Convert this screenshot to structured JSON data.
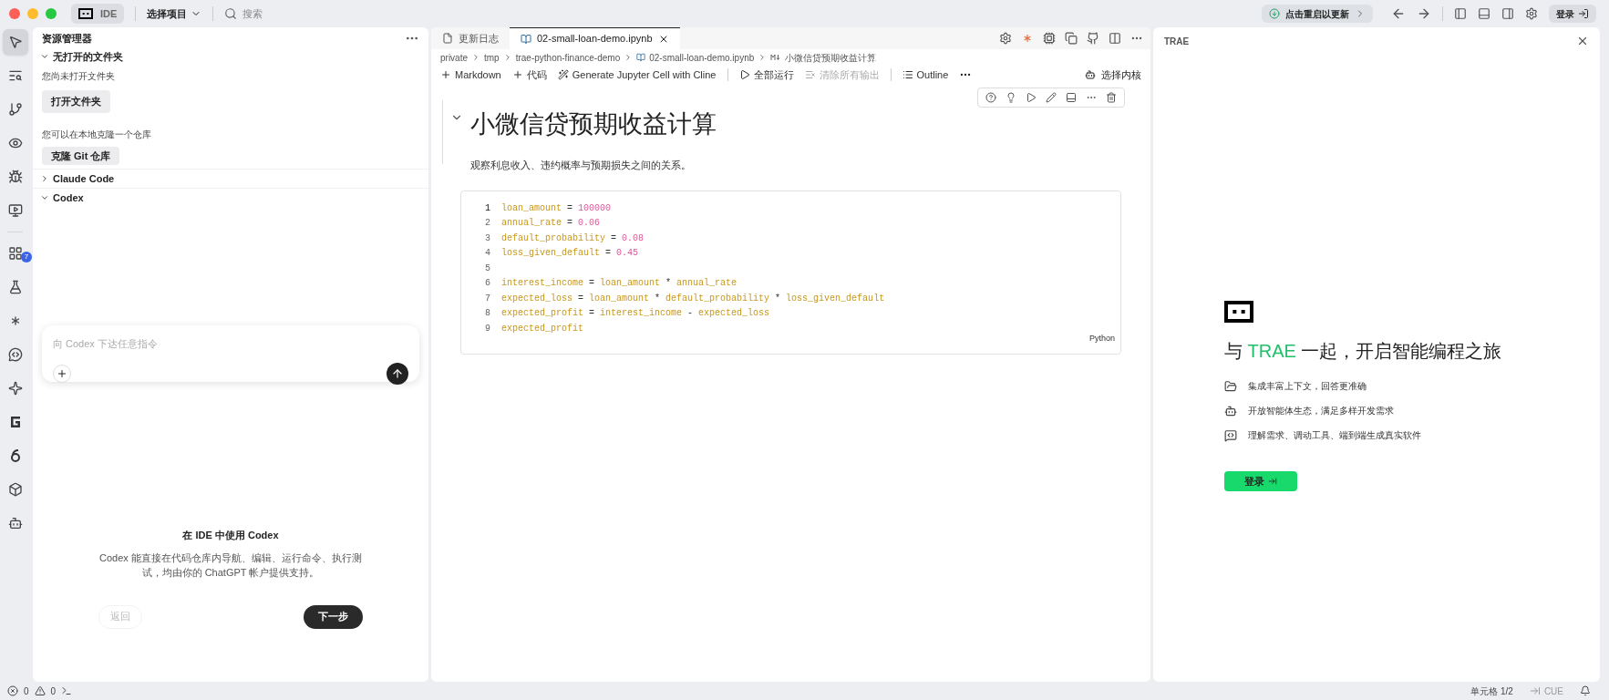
{
  "titlebar": {
    "mode_label": "IDE",
    "mode_selected": true,
    "project": "选择项目",
    "search": {
      "placeholder": "搜索"
    },
    "update": "点击重启以更新",
    "login": "登录"
  },
  "activity_bar": [
    {
      "kind": "cursor",
      "selected": true
    },
    {
      "kind": "search",
      "selected": false
    },
    {
      "kind": "branch",
      "selected": false
    },
    {
      "kind": "eye",
      "selected": false
    },
    {
      "kind": "bug",
      "selected": false
    },
    {
      "kind": "monitor",
      "selected": false
    },
    {
      "kind": "grid",
      "selected": false,
      "badge": "7"
    },
    {
      "kind": "flask",
      "selected": false
    },
    {
      "kind": "burst",
      "selected": false
    },
    {
      "kind": "chat",
      "selected": false
    },
    {
      "kind": "star",
      "selected": false
    },
    {
      "kind": "g",
      "selected": false
    },
    {
      "kind": "six",
      "selected": false
    },
    {
      "kind": "box",
      "selected": false
    },
    {
      "kind": "robot",
      "selected": false
    }
  ],
  "explorer": {
    "title": "资源管理器",
    "folder_section": {
      "title": "无打开的文件夹",
      "expanded": true,
      "message": "您尚未打开文件夹",
      "open_button": "打开文件夹",
      "clone_message": "您可以在本地克隆一个仓库",
      "clone_button": "克隆 Git 仓库"
    },
    "sections": [
      {
        "title": "Claude Code",
        "expanded": false
      },
      {
        "title": "Codex",
        "expanded": true
      }
    ],
    "codex": {
      "prompt": {
        "placeholder": "向 Codex 下达任意指令"
      },
      "heading": "在 IDE 中使用 Codex",
      "description": "Codex 能直接在代码仓库内导航、编辑、运行命令、执行测试，均由你的 ChatGPT 帐户提供支持。",
      "back_button": "返回",
      "next_button": "下一步"
    }
  },
  "editor": {
    "tabs": [
      {
        "label": "更新日志",
        "kind": "file",
        "selected": false
      },
      {
        "label": "02-small-loan-demo.ipynb",
        "kind": "notebook",
        "selected": true
      }
    ],
    "breadcrumb": [
      {
        "label": "private",
        "kind": "folder"
      },
      {
        "label": "tmp",
        "kind": "folder"
      },
      {
        "label": "trae-python-finance-demo",
        "kind": "folder"
      },
      {
        "label": "02-small-loan-demo.ipynb",
        "kind": "notebook"
      },
      {
        "label": "小微信贷预期收益计算",
        "kind": "markdown"
      }
    ],
    "toolbar": [
      {
        "label": "Markdown",
        "kind": "plus",
        "disabled": false
      },
      {
        "label": "代码",
        "kind": "plus",
        "disabled": false
      },
      {
        "label": "Generate Jupyter Cell with Cline",
        "kind": "sparkle",
        "disabled": false
      },
      {
        "label": "全部运行",
        "kind": "run",
        "disabled": false
      },
      {
        "label": "清除所有输出",
        "kind": "clear",
        "disabled": true
      },
      {
        "label": "Outline",
        "kind": "list",
        "disabled": false
      }
    ],
    "kernel": "选择内核",
    "markdown_cell": {
      "heading": "小微信贷预期收益计算",
      "text": "观察利息收入、违约概率与预期损失之间的关系。",
      "expanded": true
    },
    "code_cell": {
      "language": "Python",
      "lines": [
        {
          "number": "1",
          "active": true,
          "tokens": [
            {
              "kind": "var",
              "text": "loan_amount"
            },
            {
              "kind": "op",
              "text": " = "
            },
            {
              "kind": "num",
              "text": "100000"
            }
          ]
        },
        {
          "number": "2",
          "active": false,
          "tokens": [
            {
              "kind": "var",
              "text": "annual_rate"
            },
            {
              "kind": "op",
              "text": " = "
            },
            {
              "kind": "num",
              "text": "0.06"
            }
          ]
        },
        {
          "number": "3",
          "active": false,
          "tokens": [
            {
              "kind": "var",
              "text": "default_probability"
            },
            {
              "kind": "op",
              "text": " = "
            },
            {
              "kind": "num",
              "text": "0.08"
            }
          ]
        },
        {
          "number": "4",
          "active": false,
          "tokens": [
            {
              "kind": "var",
              "text": "loss_given_default"
            },
            {
              "kind": "op",
              "text": " = "
            },
            {
              "kind": "num",
              "text": "0.45"
            }
          ]
        },
        {
          "number": "5",
          "active": false
        },
        {
          "number": "6",
          "active": false,
          "tokens": [
            {
              "kind": "var",
              "text": "interest_income"
            },
            {
              "kind": "op",
              "text": " = "
            },
            {
              "kind": "var",
              "text": "loan_amount"
            },
            {
              "kind": "op",
              "text": " * "
            },
            {
              "kind": "var",
              "text": "annual_rate"
            }
          ]
        },
        {
          "number": "7",
          "active": false,
          "tokens": [
            {
              "kind": "var",
              "text": "expected_loss"
            },
            {
              "kind": "op",
              "text": " = "
            },
            {
              "kind": "var",
              "text": "loan_amount"
            },
            {
              "kind": "op",
              "text": " * "
            },
            {
              "kind": "var",
              "text": "default_probability"
            },
            {
              "kind": "op",
              "text": " * "
            },
            {
              "kind": "var",
              "text": "loss_given_default"
            }
          ]
        },
        {
          "number": "8",
          "active": false,
          "tokens": [
            {
              "kind": "var",
              "text": "expected_profit"
            },
            {
              "kind": "op",
              "text": " = "
            },
            {
              "kind": "var",
              "text": "interest_income"
            },
            {
              "kind": "op",
              "text": " - "
            },
            {
              "kind": "var",
              "text": "expected_loss"
            }
          ]
        },
        {
          "number": "9",
          "active": false,
          "tokens": [
            {
              "kind": "var",
              "text": "expected_profit"
            }
          ]
        }
      ]
    }
  },
  "trae_panel": {
    "title": "TRAE",
    "headline": {
      "before": "与",
      "brand": "TRAE",
      "after": "一起，开启智能编程之旅"
    },
    "features": [
      {
        "kind": "folder",
        "text": "集成丰富上下文，回答更准确"
      },
      {
        "kind": "bot",
        "text": "开放智能体生态，满足多样开发需求"
      },
      {
        "kind": "terminal",
        "text": "理解需求、调动工具、端到端生成真实软件"
      }
    ],
    "login_button": "登录"
  },
  "status_bar": {
    "errors": "0",
    "warnings": "0",
    "cell": "单元格 1/2",
    "cue": "CUE"
  }
}
